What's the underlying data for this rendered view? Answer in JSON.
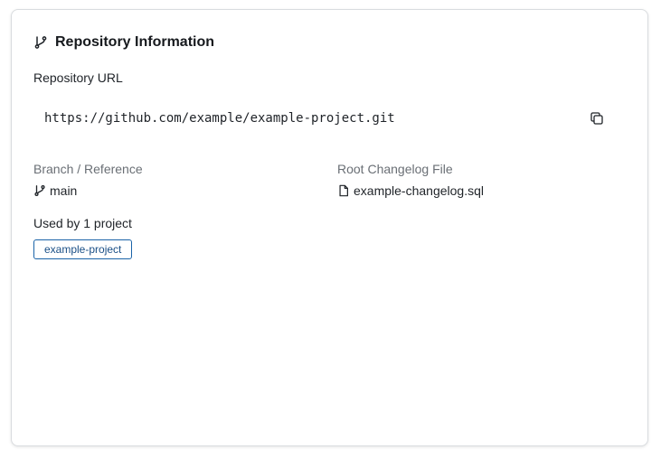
{
  "panel": {
    "title": "Repository Information",
    "title_icon": "git-branch-icon"
  },
  "repository": {
    "url_label": "Repository URL",
    "url": "https://github.com/example/example-project.git",
    "copy_icon": "copy-icon"
  },
  "branch": {
    "label": "Branch / Reference",
    "value": "main",
    "icon": "git-branch-icon"
  },
  "changelog": {
    "label": "Root Changelog File",
    "value": "example-changelog.sql",
    "icon": "file-icon"
  },
  "usage": {
    "text": "Used by 1 project",
    "projects": [
      "example-project"
    ]
  },
  "colors": {
    "tag_border": "#1a63a8",
    "tag_text": "#1a4f86",
    "muted_text": "#6a6f75"
  }
}
